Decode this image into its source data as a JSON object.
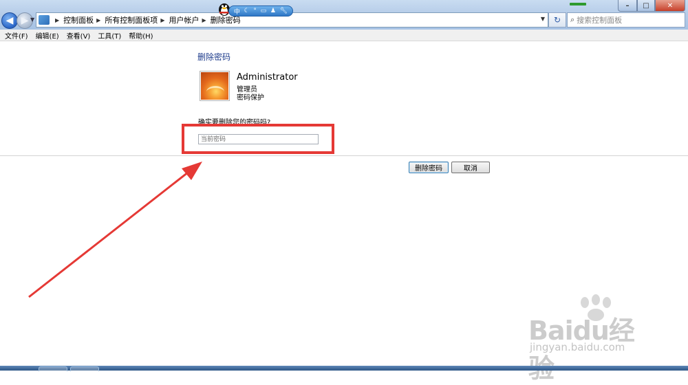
{
  "address_bar": {
    "breadcrumbs": [
      "控制面板",
      "所有控制面板项",
      "用户帐户",
      "删除密码"
    ]
  },
  "search": {
    "placeholder": "搜索控制面板"
  },
  "ime_toolbar": {
    "mode_label": "中"
  },
  "menu": {
    "items": [
      "文件(F)",
      "编辑(E)",
      "查看(V)",
      "工具(T)",
      "帮助(H)"
    ]
  },
  "page": {
    "heading": "删除密码",
    "account": {
      "name": "Administrator",
      "role": "管理员",
      "status": "密码保护"
    },
    "confirm_question": "确实要删除您的密码吗?",
    "password_placeholder": "当前密码",
    "delete_label": "删除密码",
    "cancel_label": "取消"
  },
  "watermark": {
    "logo_text": "Baidu经验",
    "url": "jingyan.baidu.com"
  },
  "colors": {
    "heading": "#1e3c8c",
    "highlight": "#e53935",
    "arrow": "#e53935"
  }
}
